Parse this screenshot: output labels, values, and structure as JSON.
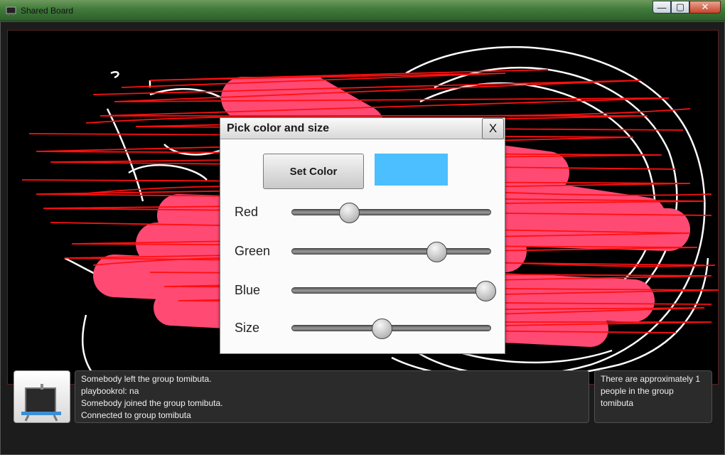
{
  "window": {
    "title": "Shared Board",
    "min_glyph": "—",
    "max_glyph": "▢",
    "close_glyph": "✕"
  },
  "dialog": {
    "title": "Pick color and size",
    "close_label": "X",
    "set_color_label": "Set Color",
    "preview_color": "#4bbfff",
    "sliders": [
      {
        "label": "Red",
        "value": 0.28
      },
      {
        "label": "Green",
        "value": 0.74
      },
      {
        "label": "Blue",
        "value": 1.0
      },
      {
        "label": "Size",
        "value": 0.45
      }
    ]
  },
  "log": {
    "lines": [
      "Somebody left the group tomibuta.",
      "playbookrol: na",
      "Somebody joined the group tomibuta.",
      "Connected to group tomibuta"
    ]
  },
  "info": {
    "text": "There are approximately 1 people in the group tomibuta"
  },
  "colors": {
    "stroke_red": "#ff1010",
    "stroke_white": "#ffffff",
    "brush_pink": "#ff4a73"
  },
  "icons": {
    "app": "board-icon",
    "logo": "whiteboard-easel-icon"
  }
}
